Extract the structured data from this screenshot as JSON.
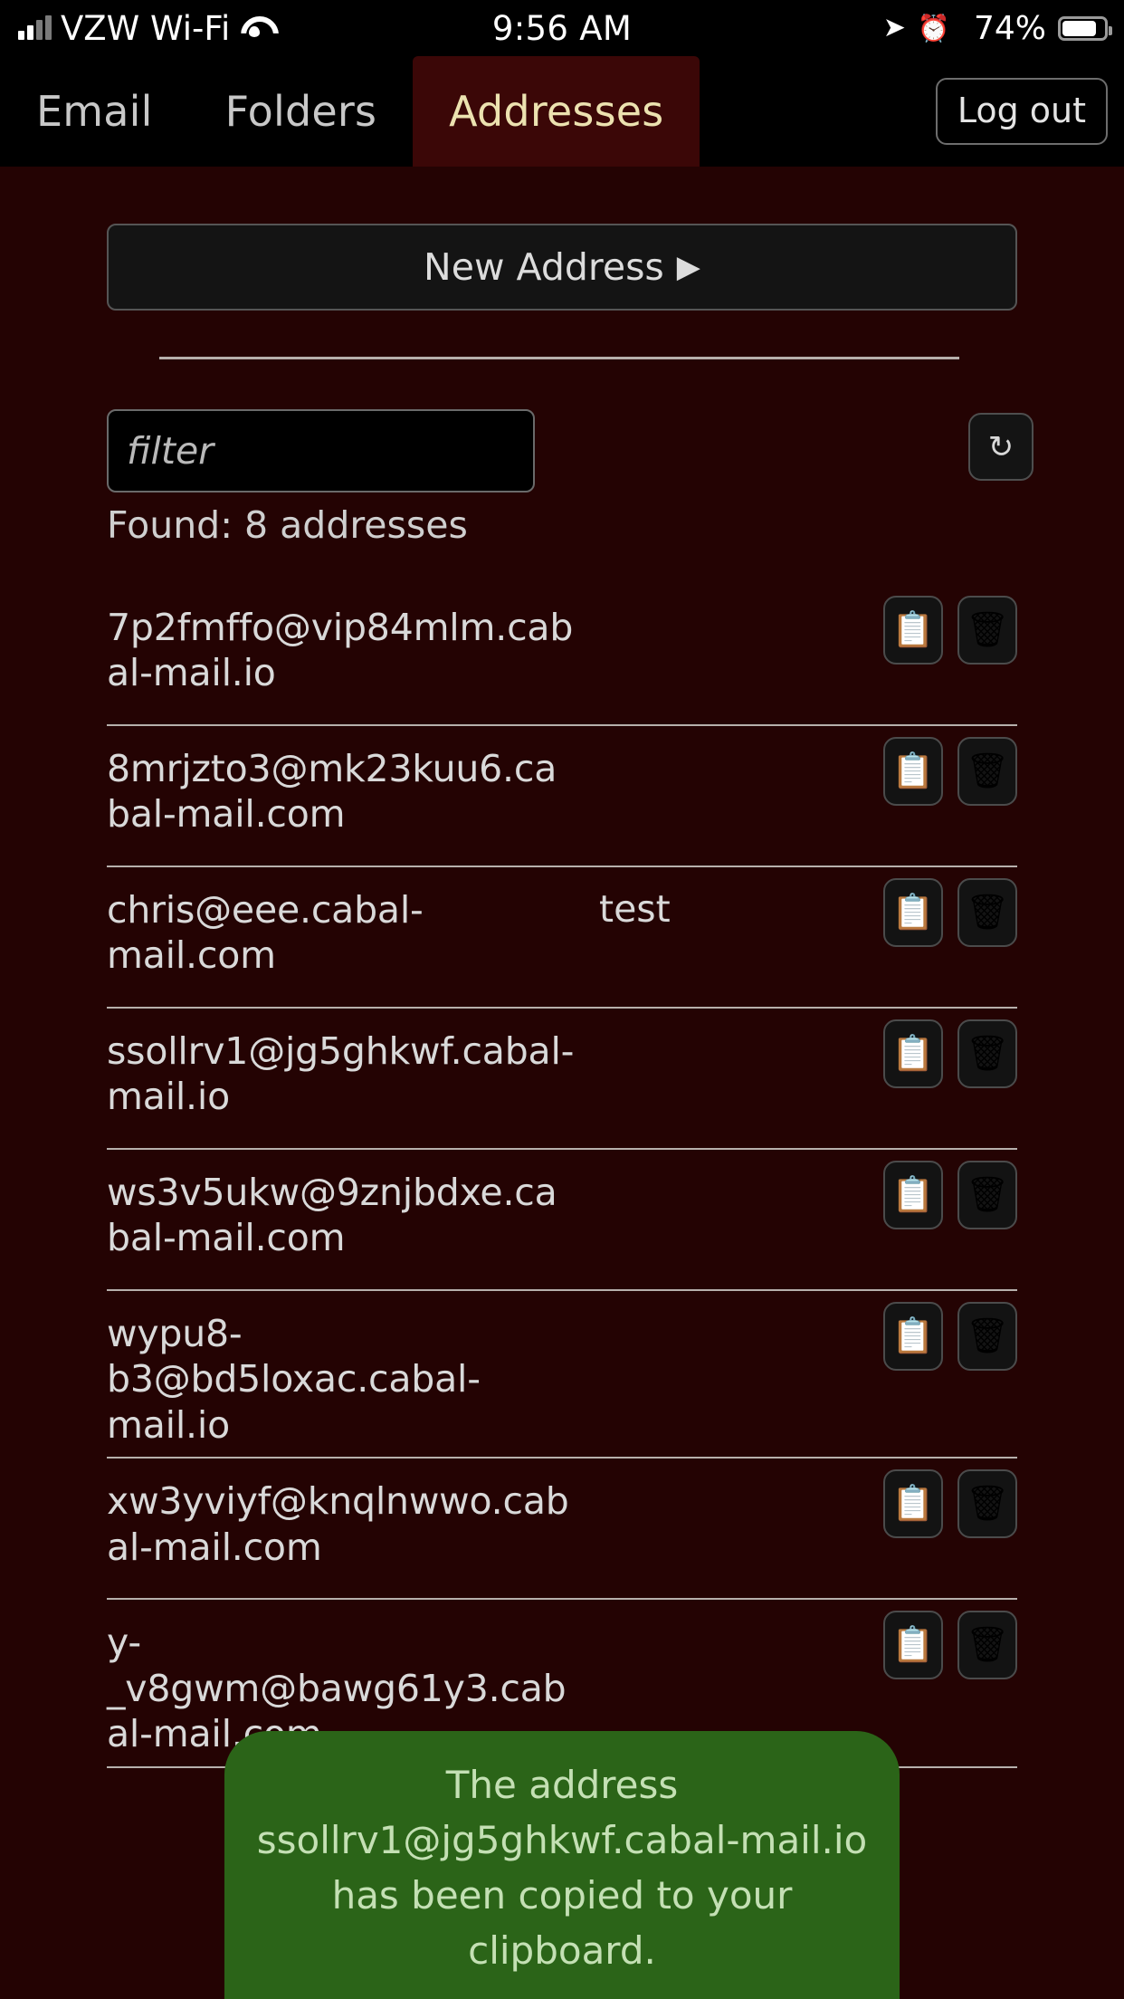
{
  "status_bar": {
    "carrier": "VZW Wi-Fi",
    "time": "9:56 AM",
    "battery_percent": "74%",
    "icons": {
      "signal": "cellular-signal-icon",
      "wifi": "wifi-icon",
      "location": "location-arrow-icon",
      "alarm": "alarm-clock-icon",
      "bluetooth": "bluetooth-icon",
      "battery": "battery-icon"
    }
  },
  "tabs": [
    {
      "label": "Email",
      "active": false
    },
    {
      "label": "Folders",
      "active": false
    },
    {
      "label": "Addresses",
      "active": true
    }
  ],
  "header": {
    "logout_label": "Log out"
  },
  "toolbar": {
    "new_address_label": "New Address",
    "new_address_caret": "▶",
    "refresh_icon": "↻"
  },
  "filter": {
    "value": "",
    "placeholder": "filter"
  },
  "found_text": "Found: 8 addresses",
  "icons": {
    "copy": "📋",
    "delete": "🗑"
  },
  "addresses": [
    {
      "email": "7p2fmffo@vip84mlm.cabal-mail.io",
      "label": ""
    },
    {
      "email": "8mrjzto3@mk23kuu6.cabal-mail.com",
      "label": ""
    },
    {
      "email": "chris@eee.cabal-mail.com",
      "label": "test"
    },
    {
      "email": "ssollrv1@jg5ghkwf.cabal-mail.io",
      "label": ""
    },
    {
      "email": "ws3v5ukw@9znjbdxe.cabal-mail.com",
      "label": ""
    },
    {
      "email": "wypu8-b3@bd5loxac.cabal-mail.io",
      "label": ""
    },
    {
      "email": "xw3yviyf@knqlnwwo.cabal-mail.com",
      "label": ""
    },
    {
      "email": "y-_v8gwm@bawg61y3.cabal-mail.com",
      "label": ""
    }
  ],
  "toast": {
    "line1": "The address",
    "line2": "ssollrv1@jg5ghkwf.cabal-mail.io",
    "line3": "has been copied to your clipboard."
  },
  "colors": {
    "background": "#240303",
    "tab_bar": "#000000",
    "active_tab_bg": "#3b0707",
    "active_tab_text": "#ece2b0",
    "button_bg": "#141414",
    "toast_bg": "#2b6418",
    "toast_text": "#c4e0b4",
    "divider": "#b7b0ac"
  }
}
